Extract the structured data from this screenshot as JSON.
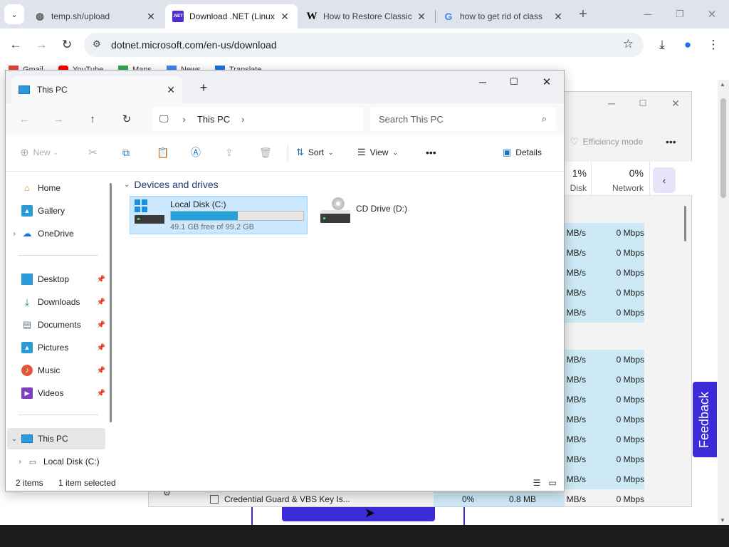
{
  "browser": {
    "tabs": [
      {
        "title": "temp.sh/upload",
        "icon": "globe-icon"
      },
      {
        "title": "Download .NET (Linux",
        "icon": "dotnet-icon",
        "active": true
      },
      {
        "title": "How to Restore Classic",
        "icon": "wikihow-icon"
      },
      {
        "title": "how to get rid of class",
        "icon": "google-icon"
      }
    ],
    "new_tab": "+",
    "url": "dotnet.microsoft.com/en-us/download",
    "bookmarks": [
      "Gmail",
      "YouTube",
      "Maps",
      "News",
      "Translate"
    ]
  },
  "task_manager": {
    "toolbar": {
      "efficiency_mode": "Efficiency mode",
      "more": "•••"
    },
    "columns": [
      {
        "pct": "1%",
        "label": "Disk"
      },
      {
        "pct": "0%",
        "label": "Network"
      }
    ],
    "disk_cells": [
      "MB/s",
      "MB/s",
      "MB/s",
      "MB/s",
      "MB/s",
      "MB/s",
      "MB/s",
      "MB/s",
      "MB/s",
      "MB/s",
      "MB/s",
      "MB/s",
      "0 MB/s"
    ],
    "network_cells": [
      "0 Mbps",
      "0 Mbps",
      "0 Mbps",
      "0 Mbps",
      "0 Mbps",
      "0 Mbps",
      "0 Mbps",
      "0 Mbps",
      "0 Mbps",
      "0 Mbps",
      "0 Mbps",
      "0 Mbps",
      "0 Mbps"
    ],
    "bottom_row": {
      "name": "Credential Guard & VBS Key Is...",
      "cpu": "0%",
      "memory": "0.8 MB"
    }
  },
  "feedback": "Feedback",
  "explorer": {
    "tab_title": "This PC",
    "new_tab": "+",
    "breadcrumb": "This PC",
    "search_placeholder": "Search This PC",
    "commands": {
      "new": "New",
      "sort": "Sort",
      "view": "View",
      "more": "•••",
      "details": "Details"
    },
    "nav": {
      "home": "Home",
      "gallery": "Gallery",
      "onedrive": "OneDrive",
      "desktop": "Desktop",
      "downloads": "Downloads",
      "documents": "Documents",
      "pictures": "Pictures",
      "music": "Music",
      "videos": "Videos",
      "this_pc": "This PC",
      "local_disk": "Local Disk (C:)"
    },
    "group_title": "Devices and drives",
    "drives": [
      {
        "name": "Local Disk (C:)",
        "free_text": "49.1 GB free of 99.2 GB",
        "used_fraction": 0.505
      },
      {
        "name": "CD Drive (D:)"
      }
    ],
    "status": {
      "items": "2 items",
      "selected": "1 item selected"
    }
  }
}
